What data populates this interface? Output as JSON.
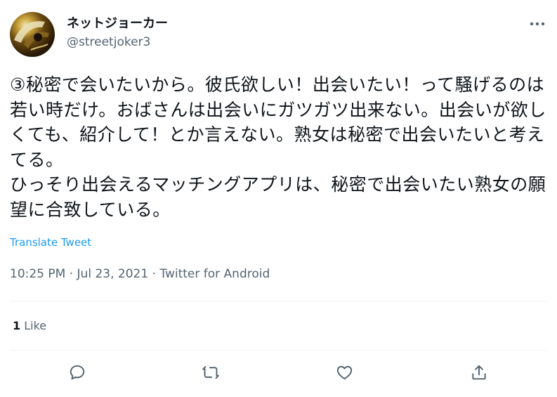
{
  "user": {
    "display_name": "ネットジョーカー",
    "handle": "@streetjoker3",
    "avatar_icon": "joker-avatar"
  },
  "tweet": {
    "text": "③秘密で会いたいから。彼氏欲しい！出会いたい！って騒げるのは若い時だけ。おばさんは出会いにガツガツ出来ない。出会いが欲しくても、紹介して！とか言えない。熟女は秘密で出会いたいと考えてる。\nひっそり出会えるマッチングアプリは、秘密で出会いたい熟女の願望に合致している。",
    "translate_label": "Translate Tweet",
    "time": "10:25 PM",
    "date": "Jul 23, 2021",
    "source": "Twitter for Android",
    "separator": " · "
  },
  "stats": {
    "like_count": "1",
    "like_label": " Like"
  },
  "actions": [
    {
      "name": "reply",
      "icon": "reply-icon"
    },
    {
      "name": "retweet",
      "icon": "retweet-icon"
    },
    {
      "name": "like",
      "icon": "heart-icon"
    },
    {
      "name": "share",
      "icon": "share-icon"
    }
  ],
  "colors": {
    "text_primary": "#0f1419",
    "text_secondary": "#536471",
    "link": "#1d9bf0",
    "divider": "#eff3f4"
  }
}
